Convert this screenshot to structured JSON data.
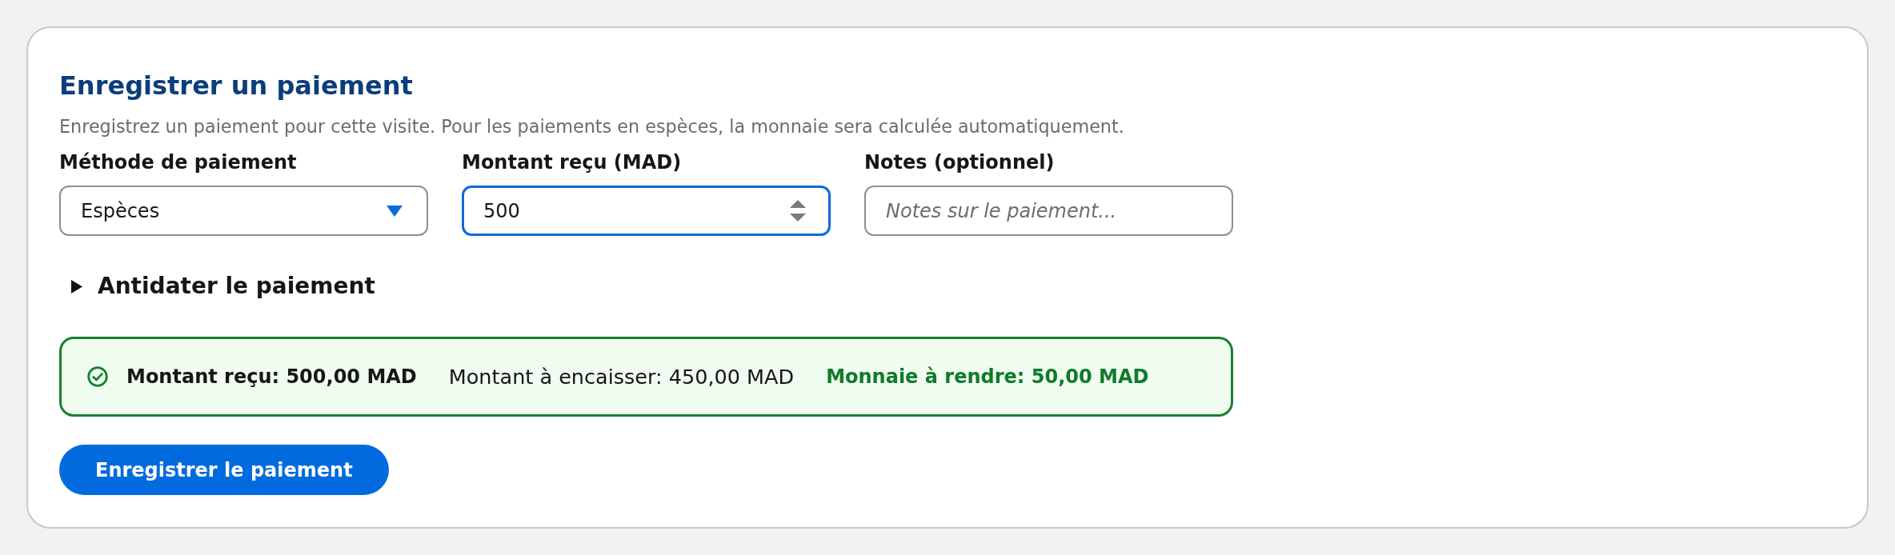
{
  "card": {
    "title": "Enregistrer un paiement",
    "description": "Enregistrez un paiement pour cette visite. Pour les paiements en espèces, la monnaie sera calculée automatiquement.",
    "fields": [
      {
        "kind": "select",
        "label": "Méthode de paiement",
        "value": "Espèces",
        "focused": false
      },
      {
        "kind": "number",
        "label": "Montant reçu (MAD)",
        "value": "500",
        "focused": true
      },
      {
        "kind": "text",
        "label": "Notes (optionnel)",
        "placeholder": "Notes sur le paiement...",
        "focused": false
      }
    ],
    "backdate": {
      "label": "Antidater le paiement",
      "expanded": false
    },
    "summary": {
      "valid": true,
      "items": [
        {
          "kind": "received",
          "text": "Montant reçu: 500,00 MAD"
        },
        {
          "kind": "due",
          "text": "Montant à encaisser: 450,00 MAD"
        },
        {
          "kind": "change",
          "text": "Monnaie à rendre: 50,00 MAD"
        }
      ]
    },
    "submit_button": {
      "label": "Enregistrer le paiement"
    }
  }
}
